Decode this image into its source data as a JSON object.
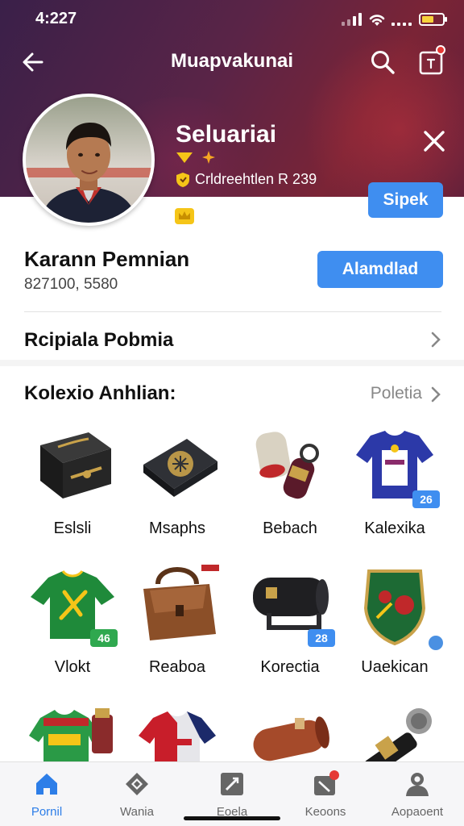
{
  "status": {
    "time": "4:227"
  },
  "topbar": {
    "title": "Muapvakunai"
  },
  "profile": {
    "name": "Seluariai",
    "subtitle": "Crldreehtlen R 239",
    "action_label": "Sipek"
  },
  "main": {
    "name": "Karann Pemnian",
    "subtitle": "827100, 5580",
    "action_label": "Alamdlad"
  },
  "row_link": {
    "label": "Rcipiala Pobmia"
  },
  "collection": {
    "title": "Kolexio Anhlian:",
    "more_label": "Poletia",
    "items": [
      {
        "name": "Eslsli",
        "icon": "dark-gift-box-icon"
      },
      {
        "name": "Msaphs",
        "icon": "dark-case-icon"
      },
      {
        "name": "Bebach",
        "icon": "capsule-keychain-icon"
      },
      {
        "name": "Kalexika",
        "icon": "blue-jersey-icon",
        "badge": "26"
      },
      {
        "name": "Vlokt",
        "icon": "green-jersey-icon",
        "badge": "46"
      },
      {
        "name": "Reaboa",
        "icon": "leather-bag-icon"
      },
      {
        "name": "Korectia",
        "icon": "black-bag-icon",
        "badge": "28"
      },
      {
        "name": "Uaekican",
        "icon": "crest-shield-icon"
      },
      {
        "name": "",
        "icon": "green-kit-icon"
      },
      {
        "name": "",
        "icon": "red-jersey-icon"
      },
      {
        "name": "",
        "icon": "scroll-roll-icon"
      },
      {
        "name": "",
        "icon": "microphone-icon"
      }
    ]
  },
  "nav": [
    {
      "label": "Pornil",
      "icon": "home-icon",
      "active": true
    },
    {
      "label": "Wania",
      "icon": "diamond-icon",
      "active": false
    },
    {
      "label": "Eoela",
      "icon": "pen-square-icon",
      "active": false
    },
    {
      "label": "Keoons",
      "icon": "tag-icon",
      "active": false
    },
    {
      "label": "Aopaoent",
      "icon": "person-icon",
      "active": false
    }
  ],
  "colors": {
    "accent": "#3f8ef0",
    "hero": "#4a2148",
    "badge_blue": "#3f8ef0",
    "badge_green": "#2fa84f"
  }
}
